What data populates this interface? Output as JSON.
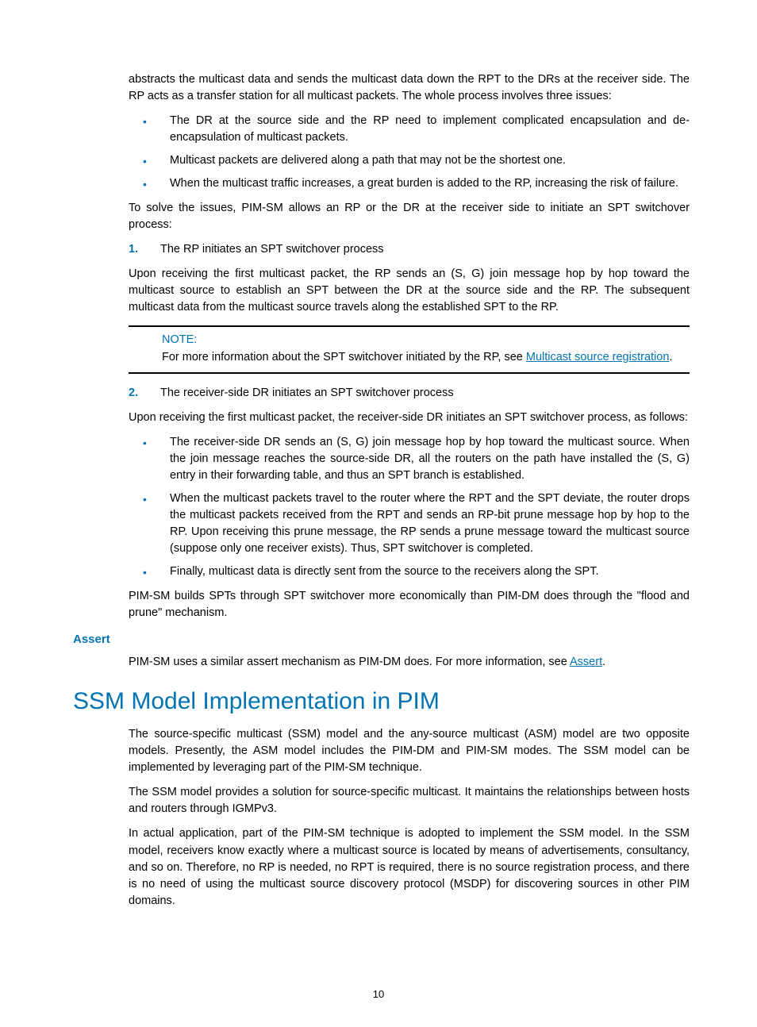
{
  "intro": {
    "p1": "abstracts the multicast data and sends the multicast data down the RPT to the DRs at the receiver side. The RP acts as a transfer station for all multicast packets. The whole process involves three issues:",
    "bullets": [
      "The DR at the source side and the RP need to implement complicated encapsulation and de-encapsulation of multicast packets.",
      "Multicast packets are delivered along a path that may not be the shortest one.",
      "When the multicast traffic increases, a great burden is added to the RP, increasing the risk of failure."
    ],
    "p2": "To solve the issues, PIM-SM allows an RP or the DR at the receiver side to initiate an SPT switchover process:"
  },
  "step1": {
    "num": "1.",
    "title": "The RP initiates an SPT switchover process",
    "p1": "Upon receiving the first multicast packet, the RP sends an (S, G) join message hop by hop toward the multicast source to establish an SPT between the DR at the source side and the RP. The subsequent multicast data from the multicast source travels along the established SPT to the RP."
  },
  "note": {
    "label": "NOTE:",
    "text_before": "For more information about the SPT switchover initiated by the RP, see ",
    "link_text": "Multicast source registration",
    "text_after": "."
  },
  "step2": {
    "num": "2.",
    "title": "The receiver-side DR initiates an SPT switchover process",
    "p1": "Upon receiving the first multicast packet, the receiver-side DR initiates an SPT switchover process, as follows:",
    "bullets": [
      "The receiver-side DR sends an (S, G) join message hop by hop toward the multicast source. When the join message reaches the source-side DR, all the routers on the path have installed the (S, G) entry in their forwarding table, and thus an SPT branch is established.",
      "When the multicast packets travel to the router where the RPT and the SPT deviate, the router drops the multicast packets received from the RPT and sends an RP-bit prune message hop by hop to the RP. Upon receiving this prune message, the RP sends a prune message toward the multicast source (suppose only one receiver exists). Thus, SPT switchover is completed.",
      "Finally, multicast data is directly sent from the source to the receivers along the SPT."
    ],
    "p2": "PIM-SM builds SPTs through SPT switchover more economically than PIM-DM does through the \"flood and prune\" mechanism."
  },
  "assert": {
    "heading": "Assert",
    "text_before": "PIM-SM uses a similar assert mechanism as PIM-DM does. For more information, see ",
    "link_text": "Assert",
    "text_after": "."
  },
  "ssm": {
    "heading": "SSM Model Implementation in PIM",
    "p1": "The source-specific multicast (SSM) model and the any-source multicast (ASM) model are two opposite models. Presently, the ASM model includes the PIM-DM and PIM-SM modes. The SSM model can be implemented by leveraging part of the PIM-SM technique.",
    "p2": "The SSM model provides a solution for source-specific multicast. It maintains the relationships between hosts and routers through IGMPv3.",
    "p3": "In actual application, part of the PIM-SM technique is adopted to implement the SSM model. In the SSM model, receivers know exactly where a multicast source is located by means of advertisements, consultancy, and so on. Therefore, no RP is needed, no RPT is required, there is no source registration process, and there is no need of using the multicast source discovery protocol (MSDP) for discovering sources in other PIM domains."
  },
  "page_number": "10"
}
